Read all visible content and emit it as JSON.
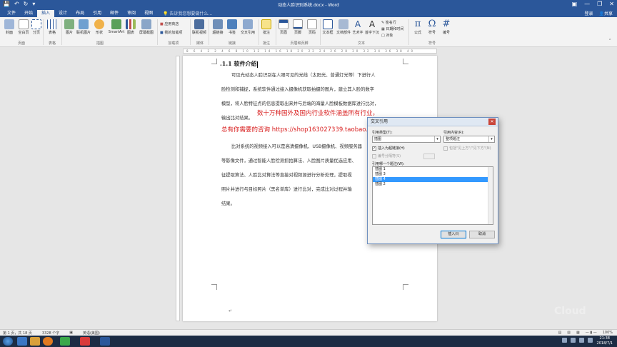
{
  "window": {
    "title": "动态人脸识别系统.docx - Word",
    "controls": [
      "—",
      "❐",
      "✕"
    ]
  },
  "tabs": [
    {
      "label": "文件"
    },
    {
      "label": "开始"
    },
    {
      "label": "插入",
      "active": true
    },
    {
      "label": "设计"
    },
    {
      "label": "布局"
    },
    {
      "label": "引用"
    },
    {
      "label": "邮件"
    },
    {
      "label": "审阅"
    },
    {
      "label": "视图"
    }
  ],
  "tell_me": "告诉我您想要做什么...",
  "account": {
    "login": "登录",
    "share": "共享"
  },
  "ribbon": {
    "buttons": {
      "cover": "封面",
      "blank_page": "空白页",
      "page_break": "分页",
      "table": "表格",
      "picture": "图片",
      "online_picture": "联机图片",
      "shapes": "形状",
      "smartart": "SmartArt",
      "chart": "图表",
      "screenshot": "屏幕截图",
      "store": "应用商店",
      "my_addins": "我的加载项",
      "online_video": "联机视频",
      "hyperlink": "超链接",
      "bookmark": "书签",
      "cross_ref": "交叉引用",
      "comment": "批注",
      "header": "页眉",
      "footer": "页脚",
      "page_number": "页码",
      "text_box": "文本框",
      "quick_parts": "文档部件",
      "wordart": "艺术字",
      "drop_cap": "首字下沉",
      "signature": "签名行",
      "date_time": "日期和时间",
      "object": "对象",
      "equation": "公式",
      "symbol": "符号",
      "numbering": "编号"
    },
    "groups": [
      "页面",
      "表格",
      "插图",
      "加载项",
      "媒体",
      "链接",
      "批注",
      "页眉和页脚",
      "文本",
      "符号"
    ]
  },
  "ruler": "8 6 4 2 2 4 6 8 10 12 14 16 18 20 22 24 26 28 30 32 34 36 38 40",
  "document": {
    "heading": ".1.1 软件介绍",
    "para1": [
      "可见光动态人脸识别在人眼可见的光线（太阳光、普通灯光等）下进行人",
      "脸检测和捕捉，系统软件通过接入摄像机获取拍摄的图片，建立其人脸的数字",
      "模型，将人脸特征点的信息提取出来并与后端的海量人脸模板数据库进行比对，",
      "输出比对结果。"
    ],
    "promo1": "数十万种国外及国内行业软件涵盖所有行业，",
    "promo2": "总有你需要的咨询 https://shop163027339.taobao.com",
    "para2": [
      "比对系统的视频接入可以是高清摄像机、USB摄像机、视频服务器",
      "等影像文件，通过智能人脸检测抓拍算法、人脸图片质量优选应用、",
      "征提取算法、人脸比对算法等直接对视频源进行分析处理，提取视",
      "照片并进行与目标照片（黑名单库）进行比对，完成比对过程并输",
      "结果。"
    ],
    "end_mark": "↵"
  },
  "dialog": {
    "title": "交叉引用",
    "close": "✕",
    "ref_type_label": "引用类型(T):",
    "ref_type_value": "插图",
    "ref_content_label": "引用内容(R):",
    "ref_content_value": "整项题注",
    "hyperlink_check": "插入为超链接(H)",
    "above_below_check": "包括\"见上方\"/\"见下方\"(N)",
    "separate_numbers_check": "编号分隔符(S)",
    "which_label": "引用哪一个题注(W):",
    "items": [
      "插图 1",
      "插图 3",
      "插图 4",
      "插图 2"
    ],
    "selected_index": 2,
    "insert": "插入(I)",
    "cancel": "取消"
  },
  "statusbar": {
    "page": "第 1 页，共 18 页",
    "words": "3328 个字",
    "lang": "英语(美国)",
    "zoom": "100%"
  },
  "taskbar": {
    "time": "21:38",
    "date": "2018/7/1"
  },
  "watermark": "Cloud",
  "colors": {
    "accent": "#2b579a",
    "promo": "#d81e1e",
    "selection": "#3399ff",
    "taskbar": "#1c2c44"
  }
}
